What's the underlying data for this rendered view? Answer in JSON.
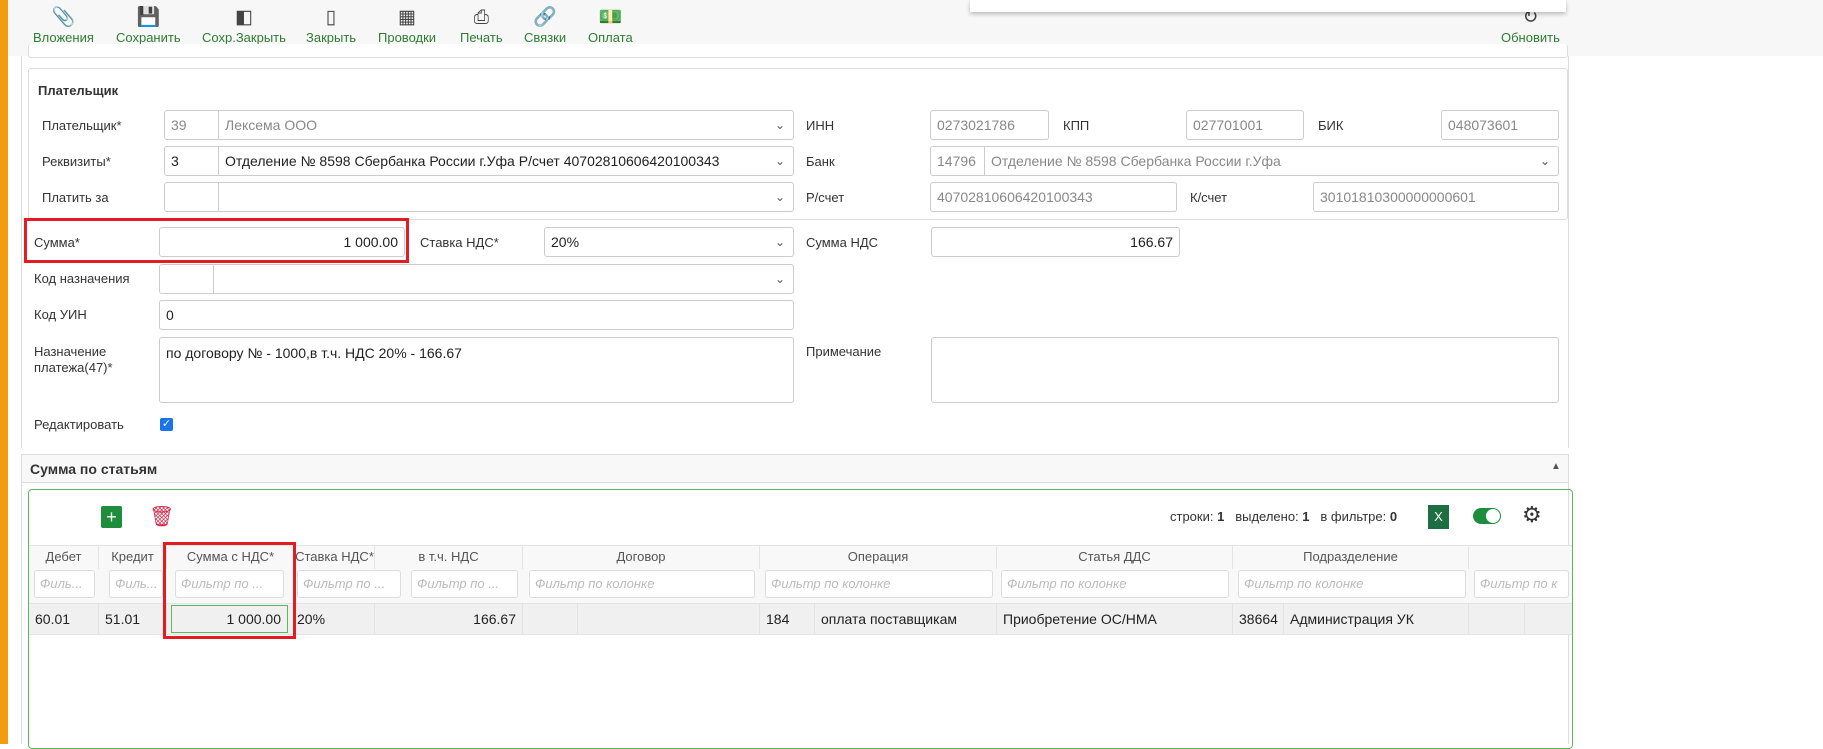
{
  "toolbar": {
    "items": [
      {
        "label": "Вложения",
        "icon": "paperclip-icon"
      },
      {
        "label": "Сохранить",
        "icon": "floppy-icon"
      },
      {
        "label": "Сохр.Закрыть",
        "icon": "door-save-icon"
      },
      {
        "label": "Закрыть",
        "icon": "door-icon"
      },
      {
        "label": "Проводки",
        "icon": "calculator-icon"
      },
      {
        "label": "Печать",
        "icon": "printer-icon"
      },
      {
        "label": "Связки",
        "icon": "link-icon"
      },
      {
        "label": "Оплата",
        "icon": "money-icon"
      }
    ],
    "refresh_label": "Обновить"
  },
  "payer": {
    "title": "Плательщик",
    "payer_label": "Плательщик*",
    "payer_code": "39",
    "payer_name": "Лексема ООО",
    "req_label": "Реквизиты*",
    "req_code": "3",
    "req_value": "Отделение № 8598 Сбербанка России г.Уфа Р/счет 40702810606420100343",
    "payfor_label": "Платить за",
    "inn_label": "ИНН",
    "inn": "0273021786",
    "kpp_label": "КПП",
    "kpp": "027701001",
    "bik_label": "БИК",
    "bik": "048073601",
    "bank_label": "Банк",
    "bank_code": "14796",
    "bank_name": "Отделение № 8598 Сбербанка России г.Уфа",
    "rs_label": "Р/счет",
    "rs": "40702810606420100343",
    "ks_label": "К/счет",
    "ks": "30101810300000000601"
  },
  "form": {
    "sum_label": "Сумма*",
    "sum": "1 000.00",
    "vat_rate_label": "Ставка НДС*",
    "vat_rate": "20%",
    "vat_sum_label": "Сумма НДС",
    "vat_sum": "166.67",
    "code_label": "Код назначения",
    "uin_label": "Код УИН",
    "uin": "0",
    "purpose_label": "Назначение платежа(47)*",
    "purpose": "по договору №   - 1000,в т.ч. НДС 20% - 166.67",
    "note_label": "Примечание",
    "edit_label": "Редактировать",
    "edit_checked": true
  },
  "articles": {
    "title": "Сумма по статьям",
    "stats": {
      "rows_label": "строки:",
      "rows": "1",
      "selected_label": "выделено:",
      "selected": "1",
      "filter_label": "в фильтре:",
      "filter": "0"
    },
    "excel_label": "X",
    "columns": [
      "Дебет",
      "Кредит",
      "Сумма с НДС*",
      "Ставка НДС*",
      "в т.ч. НДС",
      "Договор",
      "Операция",
      "Статья ДДС",
      "Подразделение"
    ],
    "filter_placeholders": [
      "Филь...",
      "Филь...",
      "Фильтр по ...",
      "Фильтр по ...",
      "Фильтр по ...",
      "Фильтр по колонке",
      "Фильтр по колонке",
      "Фильтр по колонке",
      "Фильтр по колонке",
      "Фильтр по к"
    ],
    "row": {
      "debit": "60.01",
      "credit": "51.01",
      "sum": "1 000.00",
      "rate": "20%",
      "vat": "166.67",
      "op_code": "184",
      "op": "оплата поставщикам",
      "dds": "Приобретение ОС/НМА",
      "dept_code": "38664",
      "dept": "Администрация УК"
    }
  }
}
